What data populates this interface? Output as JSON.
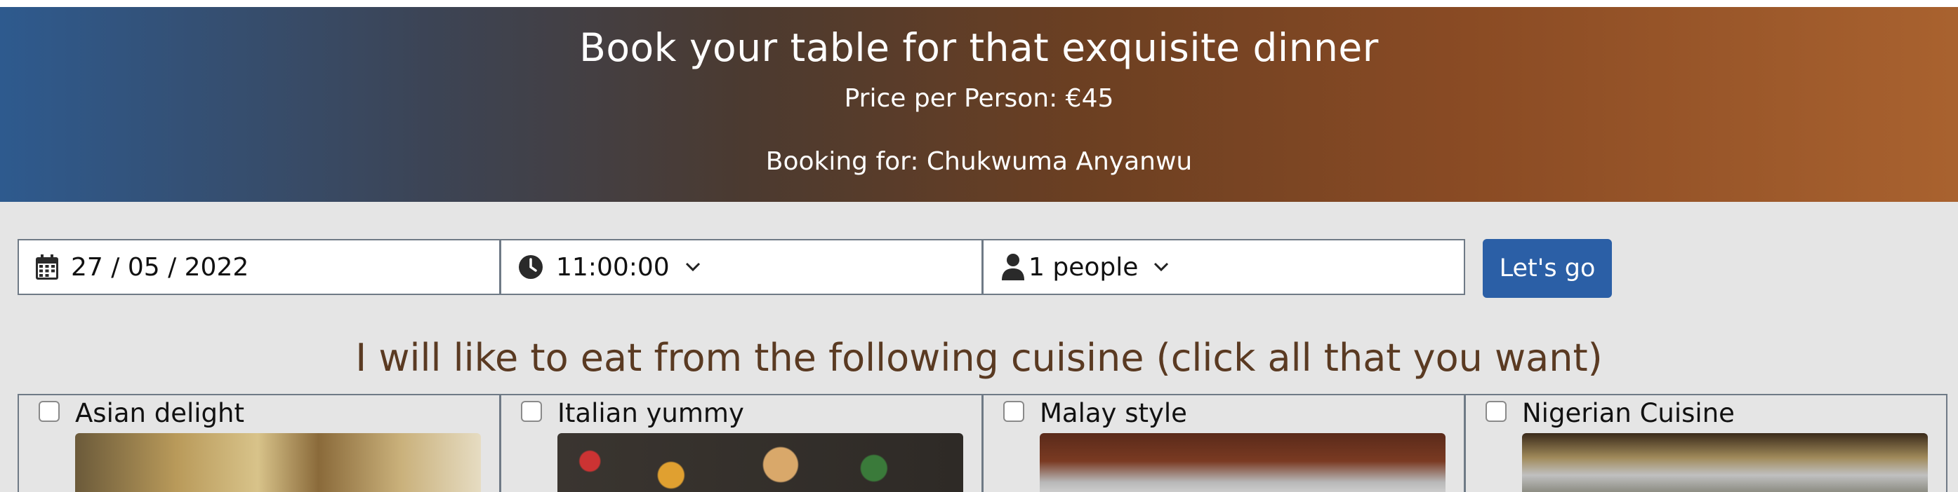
{
  "header": {
    "title": "Book your table for that exquisite dinner",
    "price": "Price per Person: €45",
    "booking": "Booking for: Chukwuma Anyanwu"
  },
  "form": {
    "date": {
      "icon": "calendar-icon",
      "value": "27 / 05 / 2022"
    },
    "time": {
      "icon": "clock-icon",
      "value": "11:00:00"
    },
    "people": {
      "icon": "person-icon",
      "value": "1 people"
    },
    "submit_label": "Let's go"
  },
  "cuisine": {
    "title": "I will like to eat from the following cuisine (click all that you want)",
    "options": [
      {
        "label": "Asian delight",
        "checked": false
      },
      {
        "label": "Italian yummy",
        "checked": false
      },
      {
        "label": "Malay style",
        "checked": false
      },
      {
        "label": "Nigerian Cuisine",
        "checked": false
      }
    ]
  },
  "colors": {
    "header_gradient_start": "#2e5a8e",
    "header_gradient_end": "#a9622f",
    "button": "#2b5fa6",
    "cuisine_title": "#5a3a22",
    "page_bg": "#e5e5e5"
  }
}
